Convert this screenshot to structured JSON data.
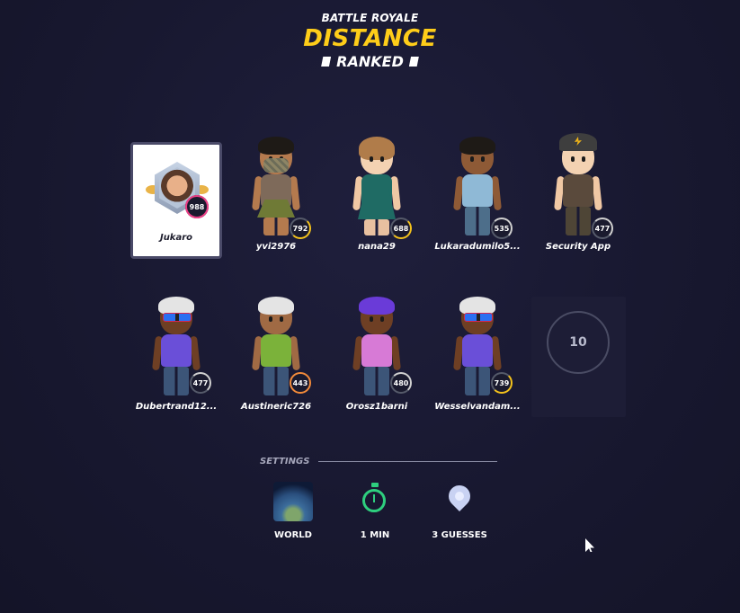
{
  "header": {
    "mode": "BATTLE ROYALE",
    "title": "DISTANCE",
    "ranked": "RANKED"
  },
  "self_player": {
    "name": "Jukaro",
    "rating": "988"
  },
  "players": [
    {
      "name": "yvi2976",
      "rating": "792",
      "ring": "gold"
    },
    {
      "name": "nana29",
      "rating": "688",
      "ring": "gold"
    },
    {
      "name": "Lukaradumilo5...",
      "rating": "535",
      "ring": "grey"
    },
    {
      "name": "Security App",
      "rating": "477",
      "ring": "grey"
    },
    {
      "name": "Dubertrand12...",
      "rating": "477",
      "ring": "grey"
    },
    {
      "name": "Austineric726",
      "rating": "443",
      "ring": "orange"
    },
    {
      "name": "Orosz1barni",
      "rating": "480",
      "ring": "grey"
    },
    {
      "name": "Wesselvandam...",
      "rating": "739",
      "ring": "gold"
    }
  ],
  "empty_slot": {
    "count": "10"
  },
  "settings": {
    "label": "SETTINGS",
    "map": "WORLD",
    "time": "1 MIN",
    "guesses": "3 GUESSES",
    "icons": [
      "globe-map-icon",
      "stopwatch-icon",
      "location-pin-icon"
    ]
  },
  "colors": {
    "background": "#181830",
    "title_yellow": "#fecd19",
    "timer_green": "#2ecf7e"
  }
}
